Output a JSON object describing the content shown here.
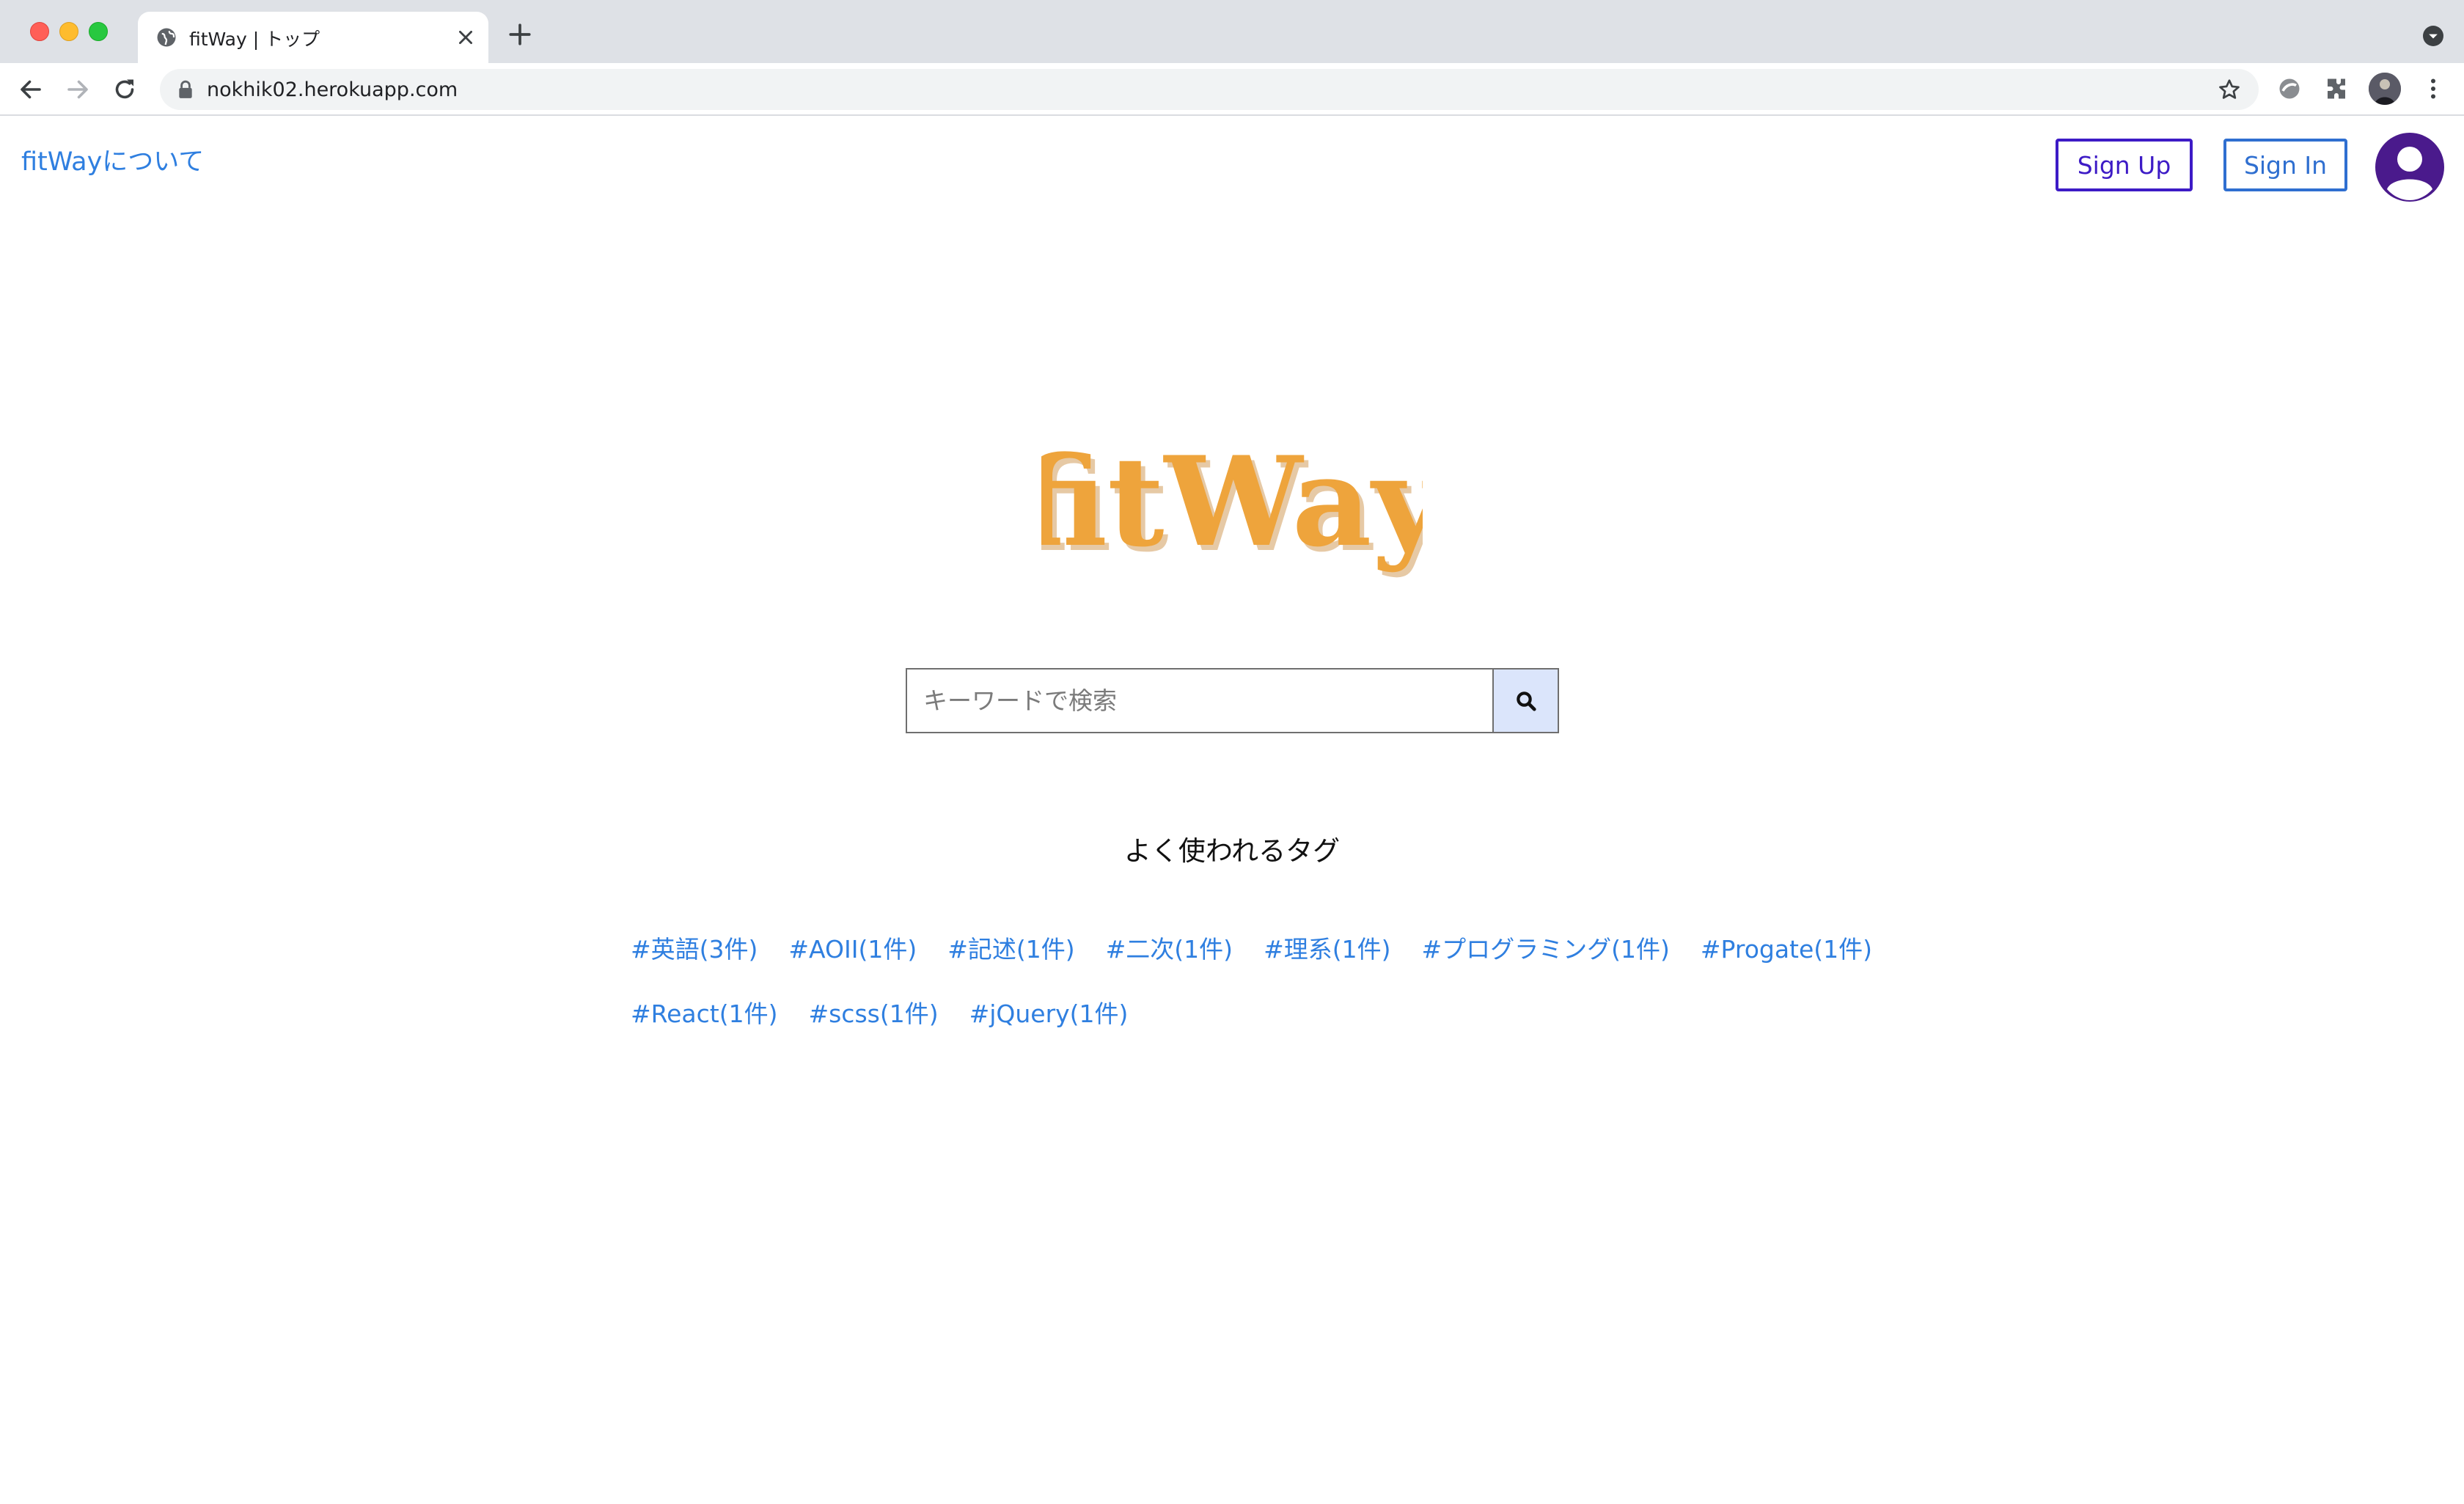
{
  "browser": {
    "tab_title": "fitWay | トップ",
    "url": "nokhik02.herokuapp.com"
  },
  "header": {
    "about_link": "fitWayについて",
    "sign_up": "Sign Up",
    "sign_in": "Sign In"
  },
  "logo": {
    "text": "fitWay",
    "color": "#eea43c"
  },
  "search": {
    "placeholder": "キーワードで検索",
    "value": ""
  },
  "tags": {
    "heading": "よく使われるタグ",
    "row1": [
      "#英語(3件)",
      "#AOII(1件)",
      "#記述(1件)",
      "#二次(1件)",
      "#理系(1件)",
      "#プログラミング(1件)",
      "#Progate(1件)"
    ],
    "row2": [
      "#React(1件)",
      "#scss(1件)",
      "#jQuery(1件)"
    ]
  },
  "colors": {
    "link": "#2f7fe0",
    "signup_border": "#3d1bc6",
    "signin_border": "#2f6fd0",
    "avatar": "#4a1a8c",
    "search_button_bg": "#dbe5fb"
  }
}
